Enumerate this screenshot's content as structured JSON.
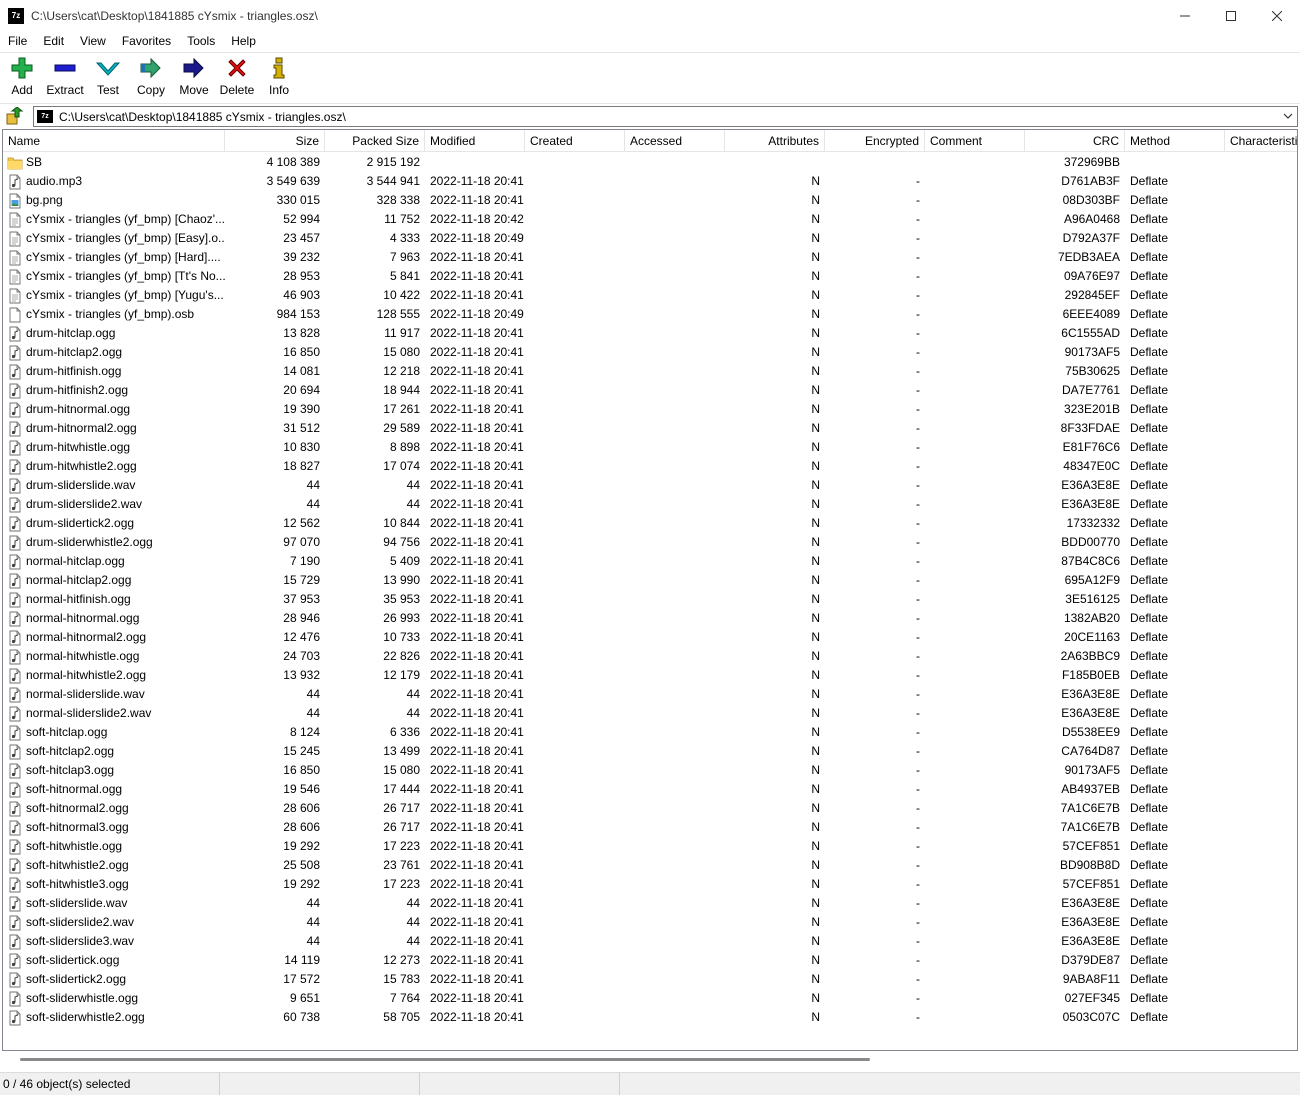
{
  "window": {
    "title": "C:\\Users\\cat\\Desktop\\1841885 cYsmix - triangles.osz\\",
    "app_icon_text": "7z"
  },
  "menu": [
    "File",
    "Edit",
    "View",
    "Favorites",
    "Tools",
    "Help"
  ],
  "toolbar": {
    "add": "Add",
    "extract": "Extract",
    "test": "Test",
    "copy": "Copy",
    "move": "Move",
    "delete": "Delete",
    "info": "Info"
  },
  "address": {
    "path": "C:\\Users\\cat\\Desktop\\1841885 cYsmix - triangles.osz\\"
  },
  "columns": {
    "name": "Name",
    "size": "Size",
    "packed": "Packed Size",
    "modified": "Modified",
    "created": "Created",
    "accessed": "Accessed",
    "attributes": "Attributes",
    "encrypted": "Encrypted",
    "comment": "Comment",
    "crc": "CRC",
    "method": "Method",
    "characteristics": "Characteristi"
  },
  "files": [
    {
      "icon": "folder",
      "name": "SB",
      "size": "4 108 389",
      "packed": "2 915 192",
      "modified": "",
      "enc": "",
      "attr": "",
      "crc": "372969BB",
      "method": ""
    },
    {
      "icon": "audio",
      "name": "audio.mp3",
      "size": "3 549 639",
      "packed": "3 544 941",
      "modified": "2022-11-18 20:41",
      "attr": "N",
      "enc": "-",
      "crc": "D761AB3F",
      "method": "Deflate"
    },
    {
      "icon": "image",
      "name": "bg.png",
      "size": "330 015",
      "packed": "328 338",
      "modified": "2022-11-18 20:41",
      "attr": "N",
      "enc": "-",
      "crc": "08D303BF",
      "method": "Deflate"
    },
    {
      "icon": "text",
      "name": "cYsmix - triangles (yf_bmp) [Chaoz'...",
      "size": "52 994",
      "packed": "11 752",
      "modified": "2022-11-18 20:42",
      "attr": "N",
      "enc": "-",
      "crc": "A96A0468",
      "method": "Deflate"
    },
    {
      "icon": "text",
      "name": "cYsmix - triangles (yf_bmp) [Easy].o...",
      "size": "23 457",
      "packed": "4 333",
      "modified": "2022-11-18 20:49",
      "attr": "N",
      "enc": "-",
      "crc": "D792A37F",
      "method": "Deflate"
    },
    {
      "icon": "text",
      "name": "cYsmix - triangles (yf_bmp) [Hard]....",
      "size": "39 232",
      "packed": "7 963",
      "modified": "2022-11-18 20:41",
      "attr": "N",
      "enc": "-",
      "crc": "7EDB3AEA",
      "method": "Deflate"
    },
    {
      "icon": "text",
      "name": "cYsmix - triangles (yf_bmp) [Tt's No...",
      "size": "28 953",
      "packed": "5 841",
      "modified": "2022-11-18 20:41",
      "attr": "N",
      "enc": "-",
      "crc": "09A76E97",
      "method": "Deflate"
    },
    {
      "icon": "text",
      "name": "cYsmix - triangles (yf_bmp) [Yugu's...",
      "size": "46 903",
      "packed": "10 422",
      "modified": "2022-11-18 20:41",
      "attr": "N",
      "enc": "-",
      "crc": "292845EF",
      "method": "Deflate"
    },
    {
      "icon": "blank",
      "name": "cYsmix - triangles (yf_bmp).osb",
      "size": "984 153",
      "packed": "128 555",
      "modified": "2022-11-18 20:49",
      "attr": "N",
      "enc": "-",
      "crc": "6EEE4089",
      "method": "Deflate"
    },
    {
      "icon": "audio",
      "name": "drum-hitclap.ogg",
      "size": "13 828",
      "packed": "11 917",
      "modified": "2022-11-18 20:41",
      "attr": "N",
      "enc": "-",
      "crc": "6C1555AD",
      "method": "Deflate"
    },
    {
      "icon": "audio",
      "name": "drum-hitclap2.ogg",
      "size": "16 850",
      "packed": "15 080",
      "modified": "2022-11-18 20:41",
      "attr": "N",
      "enc": "-",
      "crc": "90173AF5",
      "method": "Deflate"
    },
    {
      "icon": "audio",
      "name": "drum-hitfinish.ogg",
      "size": "14 081",
      "packed": "12 218",
      "modified": "2022-11-18 20:41",
      "attr": "N",
      "enc": "-",
      "crc": "75B30625",
      "method": "Deflate"
    },
    {
      "icon": "audio",
      "name": "drum-hitfinish2.ogg",
      "size": "20 694",
      "packed": "18 944",
      "modified": "2022-11-18 20:41",
      "attr": "N",
      "enc": "-",
      "crc": "DA7E7761",
      "method": "Deflate"
    },
    {
      "icon": "audio",
      "name": "drum-hitnormal.ogg",
      "size": "19 390",
      "packed": "17 261",
      "modified": "2022-11-18 20:41",
      "attr": "N",
      "enc": "-",
      "crc": "323E201B",
      "method": "Deflate"
    },
    {
      "icon": "audio",
      "name": "drum-hitnormal2.ogg",
      "size": "31 512",
      "packed": "29 589",
      "modified": "2022-11-18 20:41",
      "attr": "N",
      "enc": "-",
      "crc": "8F33FDAE",
      "method": "Deflate"
    },
    {
      "icon": "audio",
      "name": "drum-hitwhistle.ogg",
      "size": "10 830",
      "packed": "8 898",
      "modified": "2022-11-18 20:41",
      "attr": "N",
      "enc": "-",
      "crc": "E81F76C6",
      "method": "Deflate"
    },
    {
      "icon": "audio",
      "name": "drum-hitwhistle2.ogg",
      "size": "18 827",
      "packed": "17 074",
      "modified": "2022-11-18 20:41",
      "attr": "N",
      "enc": "-",
      "crc": "48347E0C",
      "method": "Deflate"
    },
    {
      "icon": "audio",
      "name": "drum-sliderslide.wav",
      "size": "44",
      "packed": "44",
      "modified": "2022-11-18 20:41",
      "attr": "N",
      "enc": "-",
      "crc": "E36A3E8E",
      "method": "Deflate"
    },
    {
      "icon": "audio",
      "name": "drum-sliderslide2.wav",
      "size": "44",
      "packed": "44",
      "modified": "2022-11-18 20:41",
      "attr": "N",
      "enc": "-",
      "crc": "E36A3E8E",
      "method": "Deflate"
    },
    {
      "icon": "audio",
      "name": "drum-slidertick2.ogg",
      "size": "12 562",
      "packed": "10 844",
      "modified": "2022-11-18 20:41",
      "attr": "N",
      "enc": "-",
      "crc": "17332332",
      "method": "Deflate"
    },
    {
      "icon": "audio",
      "name": "drum-sliderwhistle2.ogg",
      "size": "97 070",
      "packed": "94 756",
      "modified": "2022-11-18 20:41",
      "attr": "N",
      "enc": "-",
      "crc": "BDD00770",
      "method": "Deflate"
    },
    {
      "icon": "audio",
      "name": "normal-hitclap.ogg",
      "size": "7 190",
      "packed": "5 409",
      "modified": "2022-11-18 20:41",
      "attr": "N",
      "enc": "-",
      "crc": "87B4C8C6",
      "method": "Deflate"
    },
    {
      "icon": "audio",
      "name": "normal-hitclap2.ogg",
      "size": "15 729",
      "packed": "13 990",
      "modified": "2022-11-18 20:41",
      "attr": "N",
      "enc": "-",
      "crc": "695A12F9",
      "method": "Deflate"
    },
    {
      "icon": "audio",
      "name": "normal-hitfinish.ogg",
      "size": "37 953",
      "packed": "35 953",
      "modified": "2022-11-18 20:41",
      "attr": "N",
      "enc": "-",
      "crc": "3E516125",
      "method": "Deflate"
    },
    {
      "icon": "audio",
      "name": "normal-hitnormal.ogg",
      "size": "28 946",
      "packed": "26 993",
      "modified": "2022-11-18 20:41",
      "attr": "N",
      "enc": "-",
      "crc": "1382AB20",
      "method": "Deflate"
    },
    {
      "icon": "audio",
      "name": "normal-hitnormal2.ogg",
      "size": "12 476",
      "packed": "10 733",
      "modified": "2022-11-18 20:41",
      "attr": "N",
      "enc": "-",
      "crc": "20CE1163",
      "method": "Deflate"
    },
    {
      "icon": "audio",
      "name": "normal-hitwhistle.ogg",
      "size": "24 703",
      "packed": "22 826",
      "modified": "2022-11-18 20:41",
      "attr": "N",
      "enc": "-",
      "crc": "2A63BBC9",
      "method": "Deflate"
    },
    {
      "icon": "audio",
      "name": "normal-hitwhistle2.ogg",
      "size": "13 932",
      "packed": "12 179",
      "modified": "2022-11-18 20:41",
      "attr": "N",
      "enc": "-",
      "crc": "F185B0EB",
      "method": "Deflate"
    },
    {
      "icon": "audio",
      "name": "normal-sliderslide.wav",
      "size": "44",
      "packed": "44",
      "modified": "2022-11-18 20:41",
      "attr": "N",
      "enc": "-",
      "crc": "E36A3E8E",
      "method": "Deflate"
    },
    {
      "icon": "audio",
      "name": "normal-sliderslide2.wav",
      "size": "44",
      "packed": "44",
      "modified": "2022-11-18 20:41",
      "attr": "N",
      "enc": "-",
      "crc": "E36A3E8E",
      "method": "Deflate"
    },
    {
      "icon": "audio",
      "name": "soft-hitclap.ogg",
      "size": "8 124",
      "packed": "6 336",
      "modified": "2022-11-18 20:41",
      "attr": "N",
      "enc": "-",
      "crc": "D5538EE9",
      "method": "Deflate"
    },
    {
      "icon": "audio",
      "name": "soft-hitclap2.ogg",
      "size": "15 245",
      "packed": "13 499",
      "modified": "2022-11-18 20:41",
      "attr": "N",
      "enc": "-",
      "crc": "CA764D87",
      "method": "Deflate"
    },
    {
      "icon": "audio",
      "name": "soft-hitclap3.ogg",
      "size": "16 850",
      "packed": "15 080",
      "modified": "2022-11-18 20:41",
      "attr": "N",
      "enc": "-",
      "crc": "90173AF5",
      "method": "Deflate"
    },
    {
      "icon": "audio",
      "name": "soft-hitnormal.ogg",
      "size": "19 546",
      "packed": "17 444",
      "modified": "2022-11-18 20:41",
      "attr": "N",
      "enc": "-",
      "crc": "AB4937EB",
      "method": "Deflate"
    },
    {
      "icon": "audio",
      "name": "soft-hitnormal2.ogg",
      "size": "28 606",
      "packed": "26 717",
      "modified": "2022-11-18 20:41",
      "attr": "N",
      "enc": "-",
      "crc": "7A1C6E7B",
      "method": "Deflate"
    },
    {
      "icon": "audio",
      "name": "soft-hitnormal3.ogg",
      "size": "28 606",
      "packed": "26 717",
      "modified": "2022-11-18 20:41",
      "attr": "N",
      "enc": "-",
      "crc": "7A1C6E7B",
      "method": "Deflate"
    },
    {
      "icon": "audio",
      "name": "soft-hitwhistle.ogg",
      "size": "19 292",
      "packed": "17 223",
      "modified": "2022-11-18 20:41",
      "attr": "N",
      "enc": "-",
      "crc": "57CEF851",
      "method": "Deflate"
    },
    {
      "icon": "audio",
      "name": "soft-hitwhistle2.ogg",
      "size": "25 508",
      "packed": "23 761",
      "modified": "2022-11-18 20:41",
      "attr": "N",
      "enc": "-",
      "crc": "BD908B8D",
      "method": "Deflate"
    },
    {
      "icon": "audio",
      "name": "soft-hitwhistle3.ogg",
      "size": "19 292",
      "packed": "17 223",
      "modified": "2022-11-18 20:41",
      "attr": "N",
      "enc": "-",
      "crc": "57CEF851",
      "method": "Deflate"
    },
    {
      "icon": "audio",
      "name": "soft-sliderslide.wav",
      "size": "44",
      "packed": "44",
      "modified": "2022-11-18 20:41",
      "attr": "N",
      "enc": "-",
      "crc": "E36A3E8E",
      "method": "Deflate"
    },
    {
      "icon": "audio",
      "name": "soft-sliderslide2.wav",
      "size": "44",
      "packed": "44",
      "modified": "2022-11-18 20:41",
      "attr": "N",
      "enc": "-",
      "crc": "E36A3E8E",
      "method": "Deflate"
    },
    {
      "icon": "audio",
      "name": "soft-sliderslide3.wav",
      "size": "44",
      "packed": "44",
      "modified": "2022-11-18 20:41",
      "attr": "N",
      "enc": "-",
      "crc": "E36A3E8E",
      "method": "Deflate"
    },
    {
      "icon": "audio",
      "name": "soft-slidertick.ogg",
      "size": "14 119",
      "packed": "12 273",
      "modified": "2022-11-18 20:41",
      "attr": "N",
      "enc": "-",
      "crc": "D379DE87",
      "method": "Deflate"
    },
    {
      "icon": "audio",
      "name": "soft-slidertick2.ogg",
      "size": "17 572",
      "packed": "15 783",
      "modified": "2022-11-18 20:41",
      "attr": "N",
      "enc": "-",
      "crc": "9ABA8F11",
      "method": "Deflate"
    },
    {
      "icon": "audio",
      "name": "soft-sliderwhistle.ogg",
      "size": "9 651",
      "packed": "7 764",
      "modified": "2022-11-18 20:41",
      "attr": "N",
      "enc": "-",
      "crc": "027EF345",
      "method": "Deflate"
    },
    {
      "icon": "audio",
      "name": "soft-sliderwhistle2.ogg",
      "size": "60 738",
      "packed": "58 705",
      "modified": "2022-11-18 20:41",
      "attr": "N",
      "enc": "-",
      "crc": "0503C07C",
      "method": "Deflate"
    }
  ],
  "status": {
    "selection": "0 / 46 object(s) selected"
  },
  "colors": {
    "add": "#22b14c",
    "extract": "#1f1fcf",
    "test": "#00b7c7",
    "copy": "#2ea36b",
    "move": "#1a1a8c",
    "delete": "#e01010",
    "info": "#d4b000"
  }
}
